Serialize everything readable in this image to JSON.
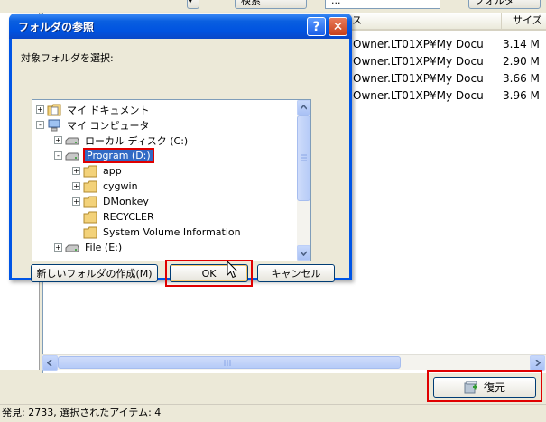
{
  "background": {
    "top_button_1": "検索",
    "top_input_value": "...",
    "top_button_2": "フォルダ",
    "column_left": "ス",
    "column_right": "サイズ",
    "rows": [
      {
        "path": "Owner.LT01XP¥My Docu",
        "size": "3.14 M"
      },
      {
        "path": "Owner.LT01XP¥My Docu",
        "size": "2.90 M"
      },
      {
        "path": "Owner.LT01XP¥My Docu",
        "size": "3.66 M"
      },
      {
        "path": "Owner.LT01XP¥My Docu",
        "size": "3.96 M"
      }
    ],
    "restore_label": "復元",
    "status": "発見: 2733, 選択されたアイテム: 4"
  },
  "dialog": {
    "title": "フォルダの参照",
    "help_label": "?",
    "close_label": "✕",
    "instruction": "対象フォルダを選択:",
    "tree": [
      {
        "label": "マイ ドキュメント",
        "level": 0,
        "expander": "+",
        "icon": "my-documents-icon"
      },
      {
        "label": "マイ コンピュータ",
        "level": 0,
        "expander": "-",
        "icon": "my-computer-icon"
      },
      {
        "label": "ローカル ディスク (C:)",
        "level": 1,
        "expander": "+",
        "icon": "drive-icon"
      },
      {
        "label": "Program (D:)",
        "level": 1,
        "expander": "-",
        "icon": "drive-icon",
        "selected": true
      },
      {
        "label": "app",
        "level": 2,
        "expander": "+",
        "icon": "folder-icon"
      },
      {
        "label": "cygwin",
        "level": 2,
        "expander": "+",
        "icon": "folder-icon"
      },
      {
        "label": "DMonkey",
        "level": 2,
        "expander": "+",
        "icon": "folder-icon"
      },
      {
        "label": "RECYCLER",
        "level": 2,
        "expander": "",
        "icon": "folder-icon"
      },
      {
        "label": "System Volume Information",
        "level": 2,
        "expander": "",
        "icon": "folder-icon"
      },
      {
        "label": "File (E:)",
        "level": 1,
        "expander": "+",
        "icon": "drive-icon"
      }
    ],
    "new_folder_label": "新しいフォルダの作成(M)",
    "ok_label": "OK",
    "cancel_label": "キャンセル"
  },
  "colors": {
    "highlight": "#e00000",
    "selection": "#316ac5",
    "titlebar": "#0053e0"
  }
}
